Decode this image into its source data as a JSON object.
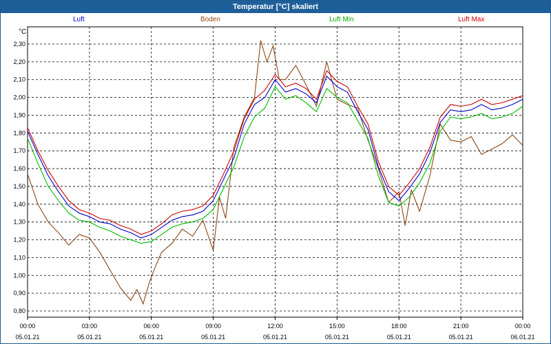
{
  "window": {
    "title": "Temperatur [°C] skaliert"
  },
  "colors": {
    "titlebar": "#1f5f99",
    "Luft": "#0000cc",
    "Boden": "#8b4513",
    "Luft Min": "#00bb00",
    "Luft Max": "#cc0000"
  },
  "chart_data": {
    "type": "line",
    "title": "Temperatur [°C] skaliert",
    "ylabel": "°C",
    "xlabel": "",
    "grid": true,
    "legend_position": "top",
    "ylim": [
      0.8,
      2.35
    ],
    "xlim": [
      0,
      24
    ],
    "yticks": [
      "0,80",
      "0,90",
      "1,00",
      "1,10",
      "1,20",
      "1,30",
      "1,40",
      "1,50",
      "1,60",
      "1,70",
      "1,80",
      "1,90",
      "2,00",
      "2,10",
      "2,20",
      "2,30"
    ],
    "xticks": [
      {
        "time": "00:00",
        "date": "05.01.21"
      },
      {
        "time": "03:00",
        "date": "05.01.21"
      },
      {
        "time": "06:00",
        "date": "05.01.21"
      },
      {
        "time": "09:00",
        "date": "05.01.21"
      },
      {
        "time": "12:00",
        "date": "05.01.21"
      },
      {
        "time": "15:00",
        "date": "05.01.21"
      },
      {
        "time": "18:00",
        "date": "05.01.21"
      },
      {
        "time": "21:00",
        "date": "05.01.21"
      },
      {
        "time": "00:00",
        "date": "06.01.21"
      }
    ],
    "series": [
      {
        "name": "Luft",
        "x": [
          0,
          0.5,
          1,
          1.5,
          2,
          2.5,
          3,
          3.5,
          4,
          4.5,
          5,
          5.5,
          6,
          6.5,
          7,
          7.5,
          8,
          8.5,
          9,
          9.5,
          10,
          10.5,
          11,
          11.5,
          12,
          12.5,
          13,
          13.5,
          14,
          14.5,
          15,
          15.5,
          16,
          16.5,
          17,
          17.5,
          18,
          18.5,
          19,
          19.5,
          20,
          20.5,
          21,
          21.5,
          22,
          22.5,
          23,
          23.5,
          24
        ],
        "values": [
          1.81,
          1.68,
          1.56,
          1.47,
          1.39,
          1.35,
          1.33,
          1.3,
          1.29,
          1.26,
          1.24,
          1.21,
          1.23,
          1.27,
          1.31,
          1.33,
          1.34,
          1.36,
          1.42,
          1.54,
          1.66,
          1.85,
          1.96,
          2.0,
          2.1,
          2.03,
          2.05,
          2.02,
          1.97,
          2.12,
          2.06,
          2.03,
          1.92,
          1.82,
          1.61,
          1.47,
          1.42,
          1.49,
          1.57,
          1.69,
          1.86,
          1.93,
          1.92,
          1.93,
          1.96,
          1.93,
          1.94,
          1.96,
          1.99
        ]
      },
      {
        "name": "Boden",
        "x": [
          0,
          0.5,
          1,
          1.5,
          2,
          2.5,
          3,
          3.5,
          4,
          4.5,
          5,
          5.3,
          5.6,
          5.9,
          6.2,
          6.5,
          7,
          7.5,
          8,
          8.5,
          9,
          9.3,
          9.6,
          10,
          10.5,
          11,
          11.3,
          11.6,
          11.9,
          12.2,
          12.5,
          13,
          13.5,
          14,
          14.5,
          15,
          15.5,
          16,
          16.5,
          17,
          17.5,
          18,
          18.3,
          18.6,
          19,
          19.5,
          20,
          20.5,
          21,
          21.5,
          22,
          22.5,
          23,
          23.5,
          24
        ],
        "values": [
          1.57,
          1.4,
          1.3,
          1.24,
          1.17,
          1.23,
          1.21,
          1.13,
          1.03,
          0.93,
          0.86,
          0.92,
          0.84,
          0.96,
          1.05,
          1.13,
          1.18,
          1.26,
          1.22,
          1.31,
          1.14,
          1.44,
          1.32,
          1.72,
          1.89,
          2.0,
          2.32,
          2.2,
          2.29,
          2.1,
          2.1,
          2.18,
          2.07,
          1.95,
          2.2,
          1.99,
          1.96,
          1.94,
          1.76,
          1.6,
          1.41,
          1.47,
          1.28,
          1.48,
          1.36,
          1.56,
          1.85,
          1.76,
          1.75,
          1.78,
          1.68,
          1.71,
          1.74,
          1.79,
          1.73
        ]
      },
      {
        "name": "Luft Min",
        "x": [
          0,
          0.5,
          1,
          1.5,
          2,
          2.5,
          3,
          3.5,
          4,
          4.5,
          5,
          5.5,
          6,
          6.5,
          7,
          7.5,
          8,
          8.5,
          9,
          9.5,
          10,
          10.5,
          11,
          11.5,
          12,
          12.5,
          13,
          13.5,
          14,
          14.5,
          15,
          15.5,
          16,
          16.5,
          17,
          17.5,
          18,
          18.5,
          19,
          19.5,
          20,
          20.5,
          21,
          21.5,
          22,
          22.5,
          23,
          23.5,
          24
        ],
        "values": [
          1.77,
          1.63,
          1.5,
          1.42,
          1.35,
          1.31,
          1.3,
          1.27,
          1.25,
          1.22,
          1.2,
          1.18,
          1.19,
          1.23,
          1.27,
          1.29,
          1.3,
          1.32,
          1.37,
          1.49,
          1.61,
          1.78,
          1.89,
          1.94,
          2.06,
          1.99,
          2.01,
          1.97,
          1.92,
          2.05,
          2.0,
          1.97,
          1.87,
          1.77,
          1.56,
          1.41,
          1.39,
          1.44,
          1.52,
          1.63,
          1.81,
          1.89,
          1.88,
          1.89,
          1.91,
          1.88,
          1.89,
          1.91,
          1.95
        ]
      },
      {
        "name": "Luft Max",
        "x": [
          0,
          0.5,
          1,
          1.5,
          2,
          2.5,
          3,
          3.5,
          4,
          4.5,
          5,
          5.5,
          6,
          6.5,
          7,
          7.5,
          8,
          8.5,
          9,
          9.5,
          10,
          10.5,
          11,
          11.5,
          12,
          12.5,
          13,
          13.5,
          14,
          14.5,
          15,
          15.5,
          16,
          16.5,
          17,
          17.5,
          18,
          18.5,
          19,
          19.5,
          20,
          20.5,
          21,
          21.5,
          22,
          22.5,
          23,
          23.5,
          24
        ],
        "values": [
          1.83,
          1.7,
          1.59,
          1.5,
          1.42,
          1.37,
          1.35,
          1.32,
          1.31,
          1.28,
          1.26,
          1.23,
          1.25,
          1.29,
          1.34,
          1.36,
          1.37,
          1.39,
          1.45,
          1.57,
          1.7,
          1.88,
          1.99,
          2.04,
          2.13,
          2.06,
          2.08,
          2.05,
          1.99,
          2.15,
          2.09,
          2.06,
          1.95,
          1.85,
          1.64,
          1.5,
          1.45,
          1.52,
          1.6,
          1.72,
          1.89,
          1.96,
          1.95,
          1.96,
          1.99,
          1.96,
          1.97,
          1.99,
          2.01
        ]
      }
    ]
  }
}
